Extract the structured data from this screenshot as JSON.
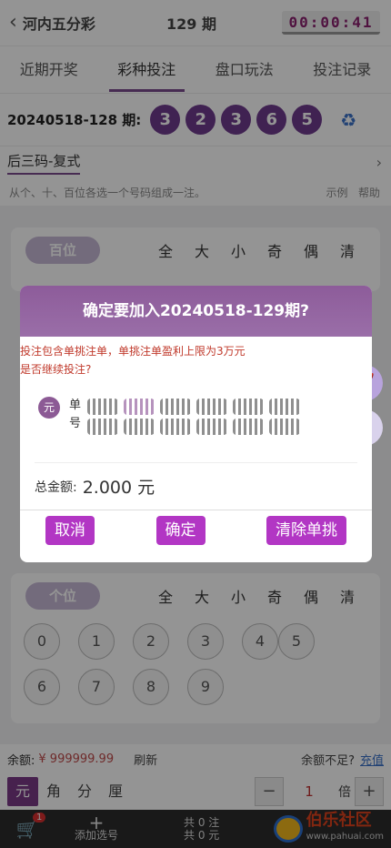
{
  "header": {
    "title": "河内五分彩",
    "period": "129 期",
    "timer": "00:00:41"
  },
  "tabs": [
    "近期开奖",
    "彩种投注",
    "盘口玩法",
    "投注记录"
  ],
  "draw": {
    "label": "20240518-128 期:",
    "balls": [
      "3",
      "2",
      "3",
      "6",
      "5"
    ]
  },
  "mode": {
    "label": "后三码-复式"
  },
  "hint": {
    "text": "从个、十、百位各选一个号码组成一注。",
    "example": "示例",
    "help": "帮助"
  },
  "card_hundreds": {
    "label": "百位",
    "quick": [
      "全",
      "大",
      "小",
      "奇",
      "偶",
      "清"
    ]
  },
  "card_ones": {
    "label": "个位",
    "quick": [
      "全",
      "大",
      "小",
      "奇",
      "偶",
      "清"
    ],
    "numbers": [
      "0",
      "1",
      "2",
      "3",
      "4",
      "5",
      "6",
      "7",
      "8",
      "9"
    ]
  },
  "balance": {
    "label": "余额:",
    "value": "¥ 999999.99",
    "refresh": "刷新",
    "insufficient": "余额不足?",
    "recharge": "充值"
  },
  "units": [
    "元",
    "角",
    "分",
    "厘"
  ],
  "multiplier": {
    "minus": "−",
    "value": "1",
    "label": "倍",
    "plus": "+"
  },
  "bottom": {
    "cart_count": "1",
    "add": "添加选号",
    "total_bets": "共 0 注",
    "total_amount": "共 0 元",
    "logo": "伯乐社区",
    "logo_url": "www.pahuai.com"
  },
  "dialog": {
    "title": "确定要加入20240518-129期?",
    "warning_1": "投注包含单挑注单，单挑注单盈利上限为3万元",
    "warning_2": "是否继续投注?",
    "unit": "元",
    "row_label_1": "单",
    "row_label_2": "号",
    "total_label": "总金额:",
    "total_value": "2.000 元",
    "cancel": "取消",
    "confirm": "确定",
    "clear": "清除单挑"
  }
}
